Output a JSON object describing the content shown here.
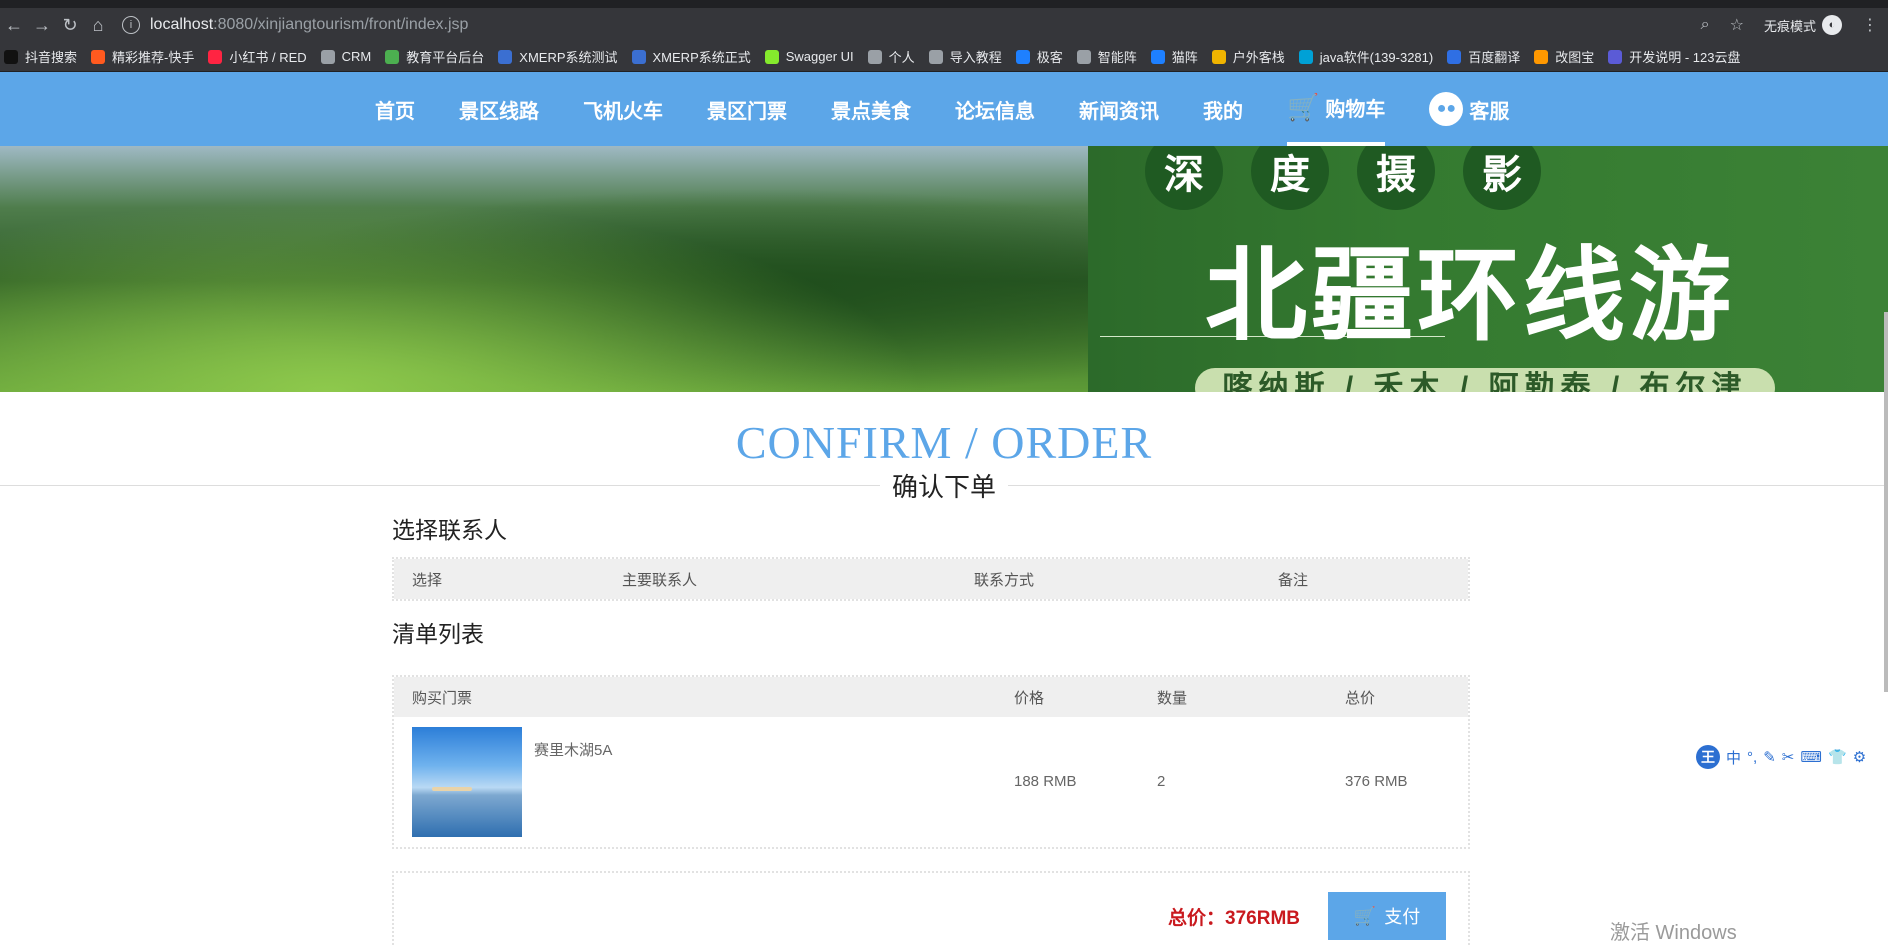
{
  "browser": {
    "url_host": "localhost",
    "url_path": ":8080/xinjiangtourism/front/index.jsp",
    "incognito_label": "无痕模式",
    "bookmarks": [
      {
        "label": "抖音搜索",
        "color": "#111111"
      },
      {
        "label": "精彩推荐-快手",
        "color": "#ff5a1f"
      },
      {
        "label": "小红书 / RED",
        "color": "#ff2442"
      },
      {
        "label": "CRM",
        "color": "#9aa0a6"
      },
      {
        "label": "教育平台后台",
        "color": "#4caf50"
      },
      {
        "label": "XMERP系统测试",
        "color": "#3b6fd1"
      },
      {
        "label": "XMERP系统正式",
        "color": "#3b6fd1"
      },
      {
        "label": "Swagger UI",
        "color": "#85ea2d"
      },
      {
        "label": "个人",
        "color": "#9aa0a6"
      },
      {
        "label": "导入教程",
        "color": "#9aa0a6"
      },
      {
        "label": "极客",
        "color": "#1e80ff"
      },
      {
        "label": "智能阵",
        "color": "#9aa0a6"
      },
      {
        "label": "猫阵",
        "color": "#1e80ff"
      },
      {
        "label": "户外客栈",
        "color": "#f0b400"
      },
      {
        "label": "java软件(139-3281)",
        "color": "#00a1d6"
      },
      {
        "label": "百度翻译",
        "color": "#2f6fe4"
      },
      {
        "label": "改图宝",
        "color": "#ff9800"
      },
      {
        "label": "开发说明 - 123云盘",
        "color": "#5b5bd6"
      }
    ]
  },
  "nav": {
    "items": [
      "首页",
      "景区线路",
      "飞机火车",
      "景区门票",
      "景点美食",
      "论坛信息",
      "新闻资讯",
      "我的"
    ],
    "cart_label": "购物车",
    "service_label": "客服"
  },
  "banner": {
    "pills": [
      "深",
      "度",
      "摄",
      "影"
    ],
    "title": "北疆环线游",
    "subtitle": "喀纳斯 / 禾木 / 阿勒泰 / 布尔津"
  },
  "page": {
    "heading_en": "CONFIRM / ORDER",
    "heading_cn": "确认下单"
  },
  "contacts": {
    "title": "选择联系人",
    "headers": [
      "选择",
      "主要联系人",
      "联系方式",
      "备注"
    ]
  },
  "order_list": {
    "title": "清单列表",
    "headers": [
      "购买门票",
      "价格",
      "数量",
      "总价"
    ],
    "rows": [
      {
        "name": "赛里木湖5A",
        "price": "188 RMB",
        "qty": "2",
        "total": "376 RMB"
      }
    ]
  },
  "payment": {
    "total_label": "总价：376RMB",
    "pay_label": "支付"
  },
  "ime": {
    "logo": "王",
    "tools": [
      "中",
      "°,",
      "✎",
      "✂",
      "⌨",
      "👕",
      "⚙"
    ]
  },
  "watermark": "激活 Windows"
}
